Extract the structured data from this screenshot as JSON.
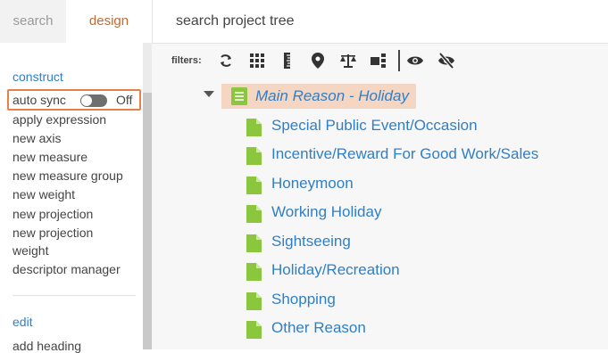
{
  "tabs": {
    "search": "search",
    "design": "design"
  },
  "tree_search": {
    "placeholder": "search project tree"
  },
  "sidebar": {
    "construct_label": "construct",
    "auto_sync": {
      "label": "auto sync",
      "state": "Off"
    },
    "construct_items": [
      "apply expression",
      "new axis",
      "new measure",
      "new measure group",
      "new weight",
      "new projection",
      "new projection",
      "weight",
      "descriptor manager"
    ],
    "edit_label": "edit",
    "edit_items": [
      "add heading"
    ]
  },
  "filters": {
    "label": "filters:",
    "icons": [
      "refresh-icon",
      "grid-icon",
      "ruler-icon",
      "location-pin-icon",
      "balance-scale-icon",
      "hierarchy-icon",
      "eye-icon",
      "eye-slash-icon"
    ]
  },
  "tree": {
    "root": "Main Reason - Holiday",
    "children": [
      "Special Public Event/Occasion",
      "Incentive/Reward For Good Work/Sales",
      "Honeymoon",
      "Working Holiday",
      "Sightseeing",
      "Holiday/Recreation",
      "Shopping",
      "Other Reason"
    ]
  },
  "colors": {
    "accent": "#c8692c",
    "link": "#2f7fc8",
    "green_icon": "#8cc63f",
    "highlight": "#f4d6c2",
    "outline": "#e8804a"
  }
}
